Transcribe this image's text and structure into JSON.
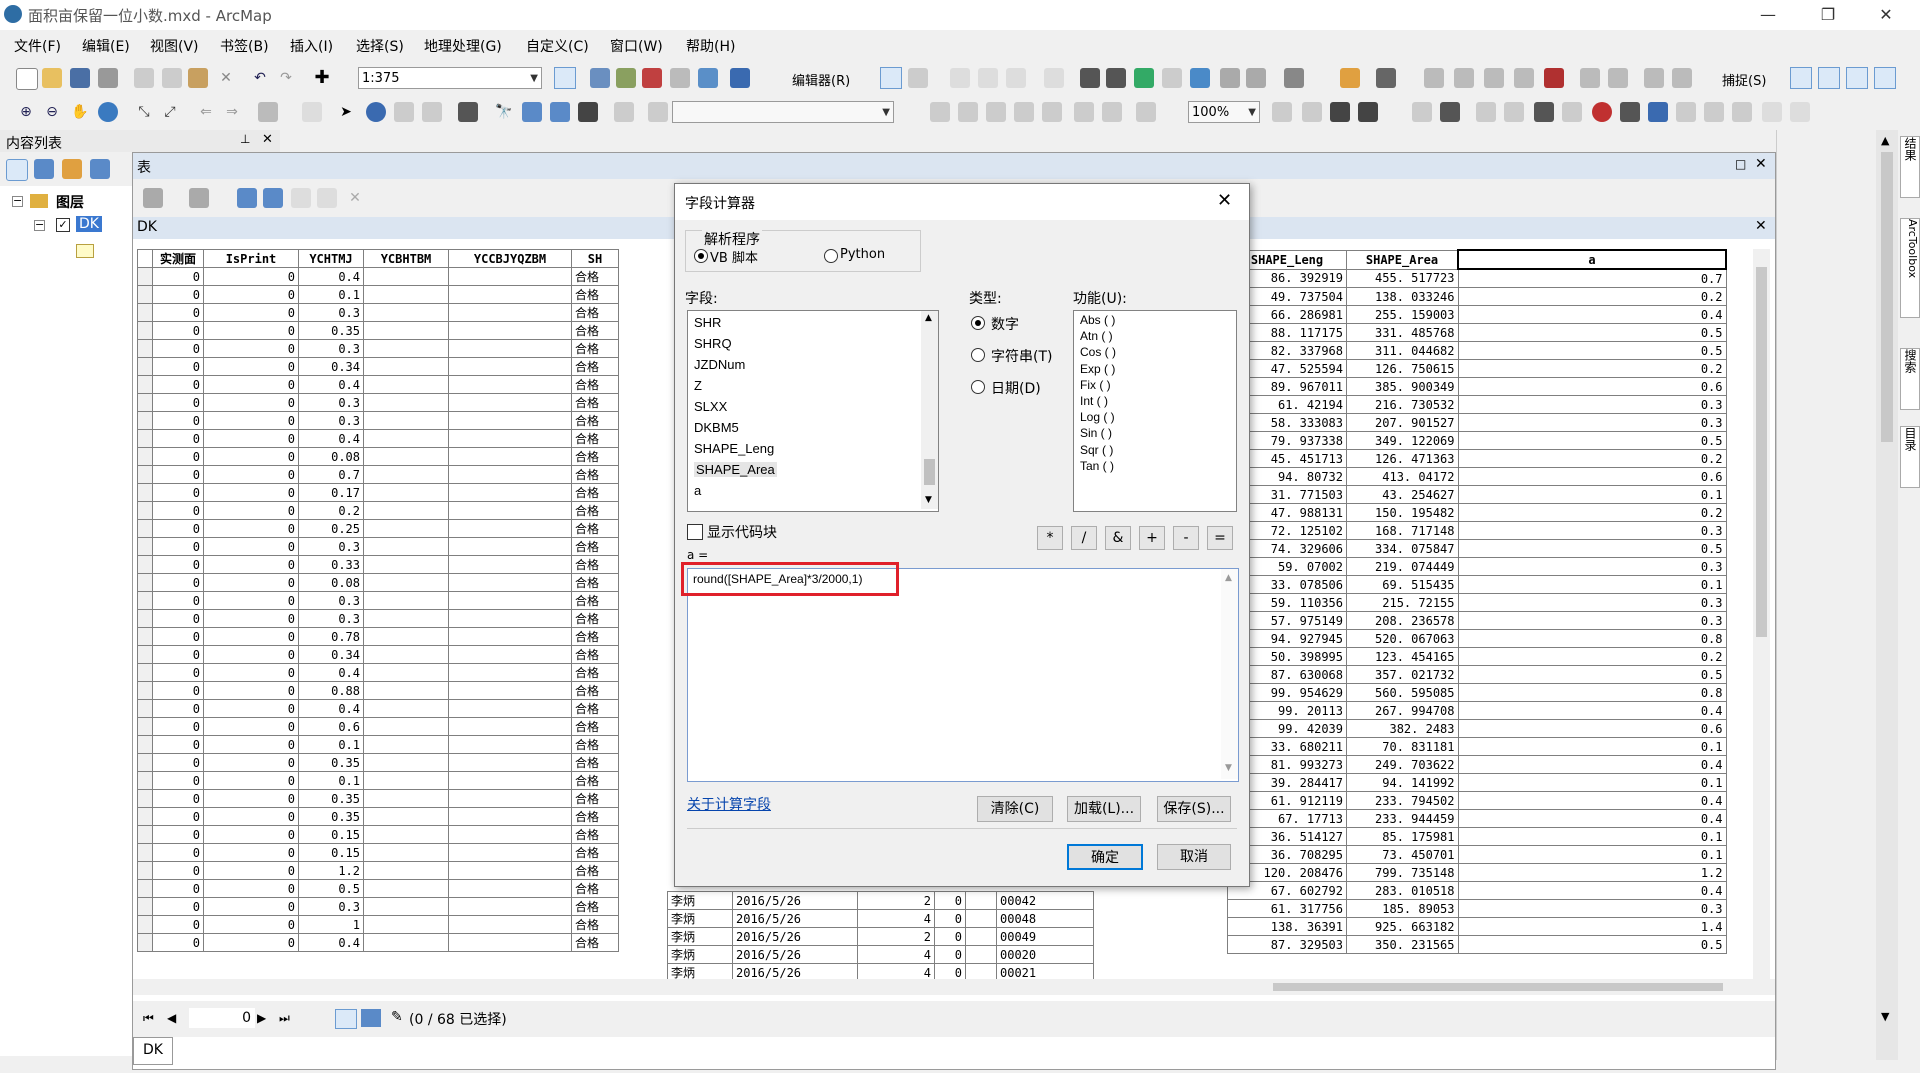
{
  "window": {
    "title": "面积亩保留一位小数.mxd - ArcMap",
    "controls": [
      "—",
      "❐",
      "✕"
    ]
  },
  "menu": [
    "文件(F)",
    "编辑(E)",
    "视图(V)",
    "书签(B)",
    "插入(I)",
    "选择(S)",
    "地理处理(G)",
    "自定义(C)",
    "窗口(W)",
    "帮助(H)"
  ],
  "toolbar": {
    "scale": "1:375",
    "editor_label": "编辑器(R)",
    "snapping_label": "捕捉(S)",
    "zoom_percent": "100%"
  },
  "toc": {
    "title": "内容列表",
    "pin": "📌",
    "close": "✕",
    "layers_label": "图层",
    "layer_name": "DK"
  },
  "table_window": {
    "title": "表",
    "layer_tab": "DK",
    "bottom_tab": "DK",
    "nav_record": "0",
    "selection_info": "(0 / 68 已选择)",
    "left_columns": [
      "实测面",
      "IsPrint",
      "YCHTMJ",
      "YCBHTBM",
      "YCCBJYQZBM",
      "SH"
    ],
    "right_columns": [
      "SHAPE_Leng",
      "SHAPE_Area",
      "a"
    ],
    "rows": [
      {
        "ycht": "0.4",
        "leng": "86. 392919",
        "area": "455. 517723",
        "a": "0.7"
      },
      {
        "ycht": "0.1",
        "leng": "49. 737504",
        "area": "138. 033246",
        "a": "0.2"
      },
      {
        "ycht": "0.3",
        "leng": "66. 286981",
        "area": "255. 159003",
        "a": "0.4"
      },
      {
        "ycht": "0.35",
        "leng": "88. 117175",
        "area": "331. 485768",
        "a": "0.5"
      },
      {
        "ycht": "0.3",
        "leng": "82. 337968",
        "area": "311. 044682",
        "a": "0.5"
      },
      {
        "ycht": "0.34",
        "leng": "47. 525594",
        "area": "126. 750615",
        "a": "0.2"
      },
      {
        "ycht": "0.4",
        "leng": "89. 967011",
        "area": "385. 900349",
        "a": "0.6"
      },
      {
        "ycht": "0.3",
        "leng": "61. 42194",
        "area": "216. 730532",
        "a": "0.3"
      },
      {
        "ycht": "0.3",
        "leng": "58. 333083",
        "area": "207. 901527",
        "a": "0.3"
      },
      {
        "ycht": "0.4",
        "leng": "79. 937338",
        "area": "349. 122069",
        "a": "0.5"
      },
      {
        "ycht": "0.08",
        "leng": "45. 451713",
        "area": "126. 471363",
        "a": "0.2"
      },
      {
        "ycht": "0.7",
        "leng": "94. 80732",
        "area": "413. 04172",
        "a": "0.6"
      },
      {
        "ycht": "0.17",
        "leng": "31. 771503",
        "area": "43. 254627",
        "a": "0.1"
      },
      {
        "ycht": "0.2",
        "leng": "47. 988131",
        "area": "150. 195482",
        "a": "0.2"
      },
      {
        "ycht": "0.25",
        "leng": "72. 125102",
        "area": "168. 717148",
        "a": "0.3"
      },
      {
        "ycht": "0.3",
        "leng": "74. 329606",
        "area": "334. 075847",
        "a": "0.5"
      },
      {
        "ycht": "0.33",
        "leng": "59. 07002",
        "area": "219. 074449",
        "a": "0.3"
      },
      {
        "ycht": "0.08",
        "leng": "33. 078506",
        "area": "69. 515435",
        "a": "0.1"
      },
      {
        "ycht": "0.3",
        "leng": "59. 110356",
        "area": "215. 72155",
        "a": "0.3"
      },
      {
        "ycht": "0.3",
        "leng": "57. 975149",
        "area": "208. 236578",
        "a": "0.3"
      },
      {
        "ycht": "0.78",
        "leng": "94. 927945",
        "area": "520. 067063",
        "a": "0.8"
      },
      {
        "ycht": "0.34",
        "leng": "50. 398995",
        "area": "123. 454165",
        "a": "0.2"
      },
      {
        "ycht": "0.4",
        "leng": "87. 630068",
        "area": "357. 021732",
        "a": "0.5"
      },
      {
        "ycht": "0.88",
        "leng": "99. 954629",
        "area": "560. 595085",
        "a": "0.8"
      },
      {
        "ycht": "0.4",
        "leng": "99. 20113",
        "area": "267. 994708",
        "a": "0.4"
      },
      {
        "ycht": "0.6",
        "leng": "99. 42039",
        "area": "382. 2483",
        "a": "0.6"
      },
      {
        "ycht": "0.1",
        "leng": "33. 680211",
        "area": "70. 831181",
        "a": "0.1"
      },
      {
        "ycht": "0.35",
        "leng": "81. 993273",
        "area": "249. 703622",
        "a": "0.4"
      },
      {
        "ycht": "0.1",
        "leng": "39. 284417",
        "area": "94. 141992",
        "a": "0.1"
      },
      {
        "ycht": "0.35",
        "leng": "61. 912119",
        "area": "233. 794502",
        "a": "0.4"
      },
      {
        "ycht": "0.35",
        "leng": "67. 17713",
        "area": "233. 944459",
        "a": "0.4"
      },
      {
        "ycht": "0.15",
        "leng": "36. 514127",
        "area": "85. 175981",
        "a": "0.1"
      },
      {
        "ycht": "0.15",
        "leng": "36. 708295",
        "area": "73. 450701",
        "a": "0.1"
      }
    ],
    "bottom_rows": [
      {
        "ycht": "1.2",
        "sh": "合格",
        "name": "李炳",
        "date": "2016/5/26",
        "n1": "2",
        "n2": "0",
        "code": "00042",
        "leng": "120. 208476",
        "area": "799. 735148",
        "a": "1.2"
      },
      {
        "ycht": "0.5",
        "sh": "合格",
        "name": "李炳",
        "date": "2016/5/26",
        "n1": "4",
        "n2": "0",
        "code": "00048",
        "leng": "67. 602792",
        "area": "283. 010518",
        "a": "0.4"
      },
      {
        "ycht": "0.3",
        "sh": "合格",
        "name": "李炳",
        "date": "2016/5/26",
        "n1": "2",
        "n2": "0",
        "code": "00049",
        "leng": "61. 317756",
        "area": "185. 89053",
        "a": "0.3"
      },
      {
        "ycht": "1",
        "sh": "合格",
        "name": "李炳",
        "date": "2016/5/26",
        "n1": "4",
        "n2": "0",
        "code": "00020",
        "leng": "138. 36391",
        "area": "925. 663182",
        "a": "1.4"
      },
      {
        "ycht": "0.4",
        "sh": "合格",
        "name": "李炳",
        "date": "2016/5/26",
        "n1": "4",
        "n2": "0",
        "code": "00021",
        "leng": "87. 329503",
        "area": "350. 231565",
        "a": "0.5"
      }
    ],
    "sh_cell": "合格"
  },
  "dialog": {
    "title": "字段计算器",
    "parser_group": "解析程序",
    "parser_vb": "VB 脚本",
    "parser_python": "Python",
    "fields_label": "字段:",
    "fields": [
      "SHR",
      "SHRQ",
      "JZDNum",
      "Z",
      "SLXX",
      "DKBM5",
      "SHAPE_Leng",
      "SHAPE_Area",
      "a"
    ],
    "type_label": "类型:",
    "type_number": "数字",
    "type_string": "字符串(T)",
    "type_date": "日期(D)",
    "functions_label": "功能(U):",
    "functions": [
      "Abs ( )",
      "Atn ( )",
      "Cos ( )",
      "Exp ( )",
      "Fix ( )",
      "Int ( )",
      "Log ( )",
      "Sin ( )",
      "Sqr ( )",
      "Tan ( )"
    ],
    "show_codeblock": "显示代码块",
    "operators": [
      "*",
      "/",
      "&",
      "+",
      "-",
      "="
    ],
    "expr_label": "a =",
    "expression": "round([SHAPE_Area]*3/2000,1)",
    "about_link": "关于计算字段",
    "clear_btn": "清除(C)",
    "load_btn": "加载(L)...",
    "save_btn": "保存(S)...",
    "ok_btn": "确定",
    "cancel_btn": "取消"
  },
  "right_panel": [
    "结果",
    "ArcToolbox",
    "搜索",
    "目录"
  ]
}
